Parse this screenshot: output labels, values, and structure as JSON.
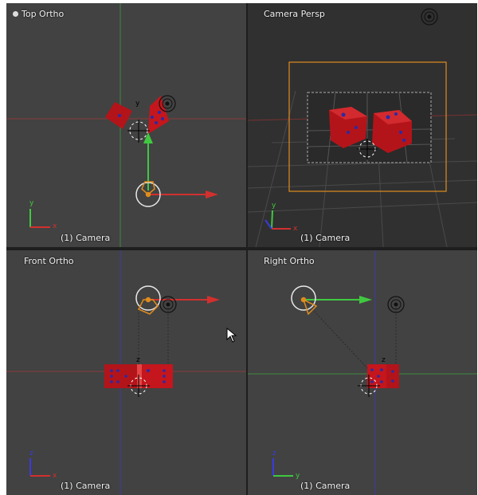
{
  "viewports": {
    "top": {
      "title": "Top Ortho",
      "footer": "(1) Camera"
    },
    "cam": {
      "title": "Camera Persp",
      "footer": "(1) Camera"
    },
    "front": {
      "title": "Front Ortho",
      "footer": "(1) Camera"
    },
    "right": {
      "title": "Right Ortho",
      "footer": "(1) Camera"
    }
  },
  "axis_labels": {
    "x": "x",
    "y": "y",
    "z": "z"
  },
  "colors": {
    "viewport_bg": "#424242",
    "camera_view_bg": "#303030",
    "die_red": "#c0141a",
    "pip_blue": "#2a2aa8",
    "axis_x": "#d2302e",
    "axis_y": "#40c840",
    "axis_z": "#3a3ae0",
    "camera_frame": "#e08c1c"
  },
  "icons": [
    "viewport-menu-icon",
    "lamp-icon",
    "camera-icon",
    "mouse-cursor-icon"
  ]
}
